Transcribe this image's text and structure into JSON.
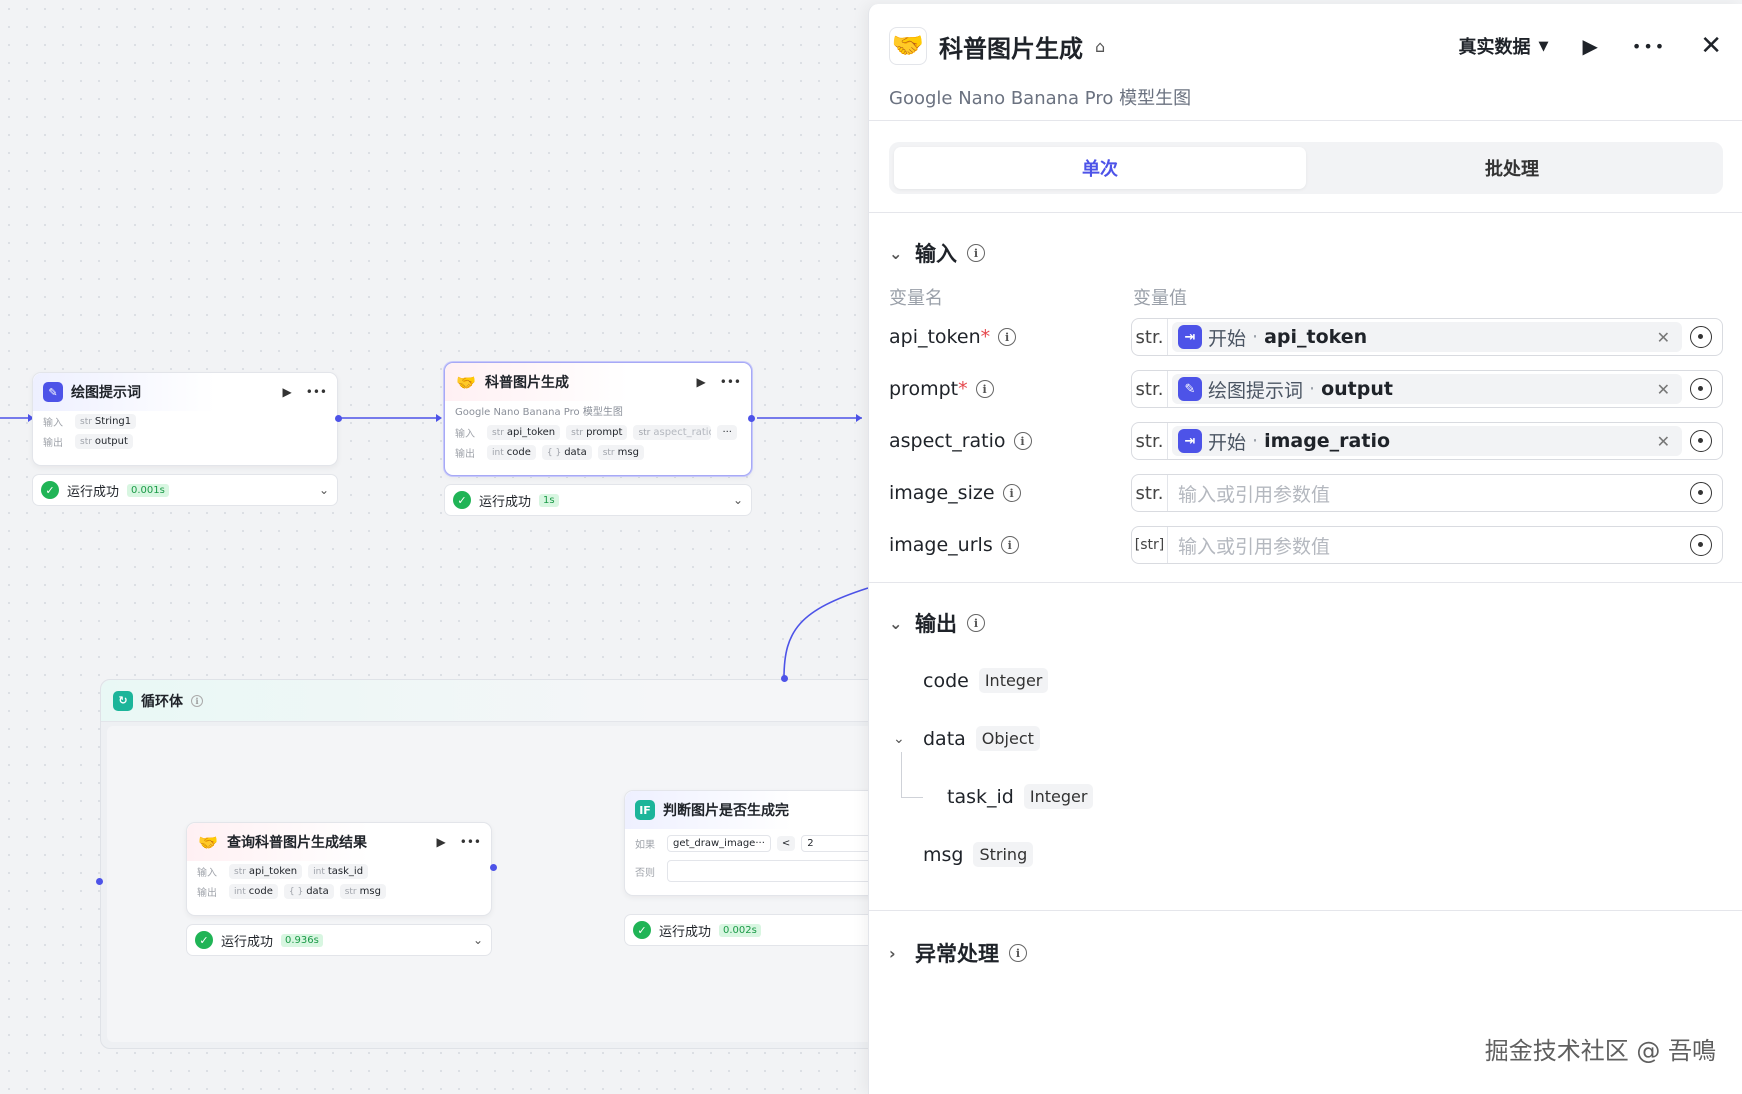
{
  "canvas": {
    "node_prompt": {
      "title": "绘图提示词",
      "in_label": "输入",
      "in_param": {
        "type": "str",
        "name": "String1"
      },
      "out_label": "输出",
      "out_param": {
        "type": "str",
        "name": "output"
      },
      "status": "运行成功",
      "time": "0.001s"
    },
    "node_image": {
      "title": "科普图片生成",
      "desc": "Google Nano Banana Pro 模型生图",
      "in_label": "输入",
      "in_params": [
        {
          "type": "str",
          "name": "api_token"
        },
        {
          "type": "str",
          "name": "prompt"
        },
        {
          "type": "str",
          "name": "aspect_ratio"
        }
      ],
      "out_label": "输出",
      "out_params": [
        {
          "type": "int",
          "name": "code"
        },
        {
          "type": "{ }",
          "name": "data"
        },
        {
          "type": "str",
          "name": "msg"
        }
      ],
      "status": "运行成功",
      "time": "1s"
    },
    "loop": {
      "title": "循环体"
    },
    "node_query": {
      "title": "查询科普图片生成结果",
      "in_label": "输入",
      "in_params": [
        {
          "type": "str",
          "name": "api_token"
        },
        {
          "type": "int",
          "name": "task_id"
        }
      ],
      "out_label": "输出",
      "out_params": [
        {
          "type": "int",
          "name": "code"
        },
        {
          "type": "{ }",
          "name": "data"
        },
        {
          "type": "str",
          "name": "msg"
        }
      ],
      "status": "运行成功",
      "time": "0.936s"
    },
    "node_if": {
      "title": "判断图片是否生成完",
      "if_label": "如果",
      "else_label": "否则",
      "cond_left": "get_draw_image···",
      "cond_op": "<",
      "cond_right": "2",
      "status": "运行成功",
      "time": "0.002s"
    }
  },
  "panel": {
    "title": "科普图片生成",
    "mode": "真实数据",
    "desc": "Google Nano Banana Pro 模型生图",
    "tabs": [
      "单次",
      "批处理"
    ],
    "input_section": "输入",
    "col_name": "变量名",
    "col_value": "变量值",
    "inputs": [
      {
        "name": "api_token",
        "required": "*",
        "type": "str.",
        "ref_node": "开始",
        "ref_var": "api_token"
      },
      {
        "name": "prompt",
        "required": "*",
        "type": "str.",
        "ref_node": "绘图提示词",
        "ref_var": "output"
      },
      {
        "name": "aspect_ratio",
        "required": "",
        "type": "str.",
        "ref_node": "开始",
        "ref_var": "image_ratio"
      },
      {
        "name": "image_size",
        "required": "",
        "type": "str.",
        "placeholder": "输入或引用参数值"
      },
      {
        "name": "image_urls",
        "required": "",
        "type": "[str]",
        "placeholder": "输入或引用参数值"
      }
    ],
    "output_section": "输出",
    "outputs": [
      {
        "name": "code",
        "type": "Integer"
      },
      {
        "name": "data",
        "type": "Object"
      },
      {
        "name": "task_id",
        "type": "Integer"
      },
      {
        "name": "msg",
        "type": "String"
      }
    ],
    "error_section": "异常处理"
  },
  "watermark": "掘金技术社区 @ 吾鳴",
  "colors": {
    "accent": "#4d53e8",
    "success": "#20b456",
    "teal": "#1cb59a"
  }
}
